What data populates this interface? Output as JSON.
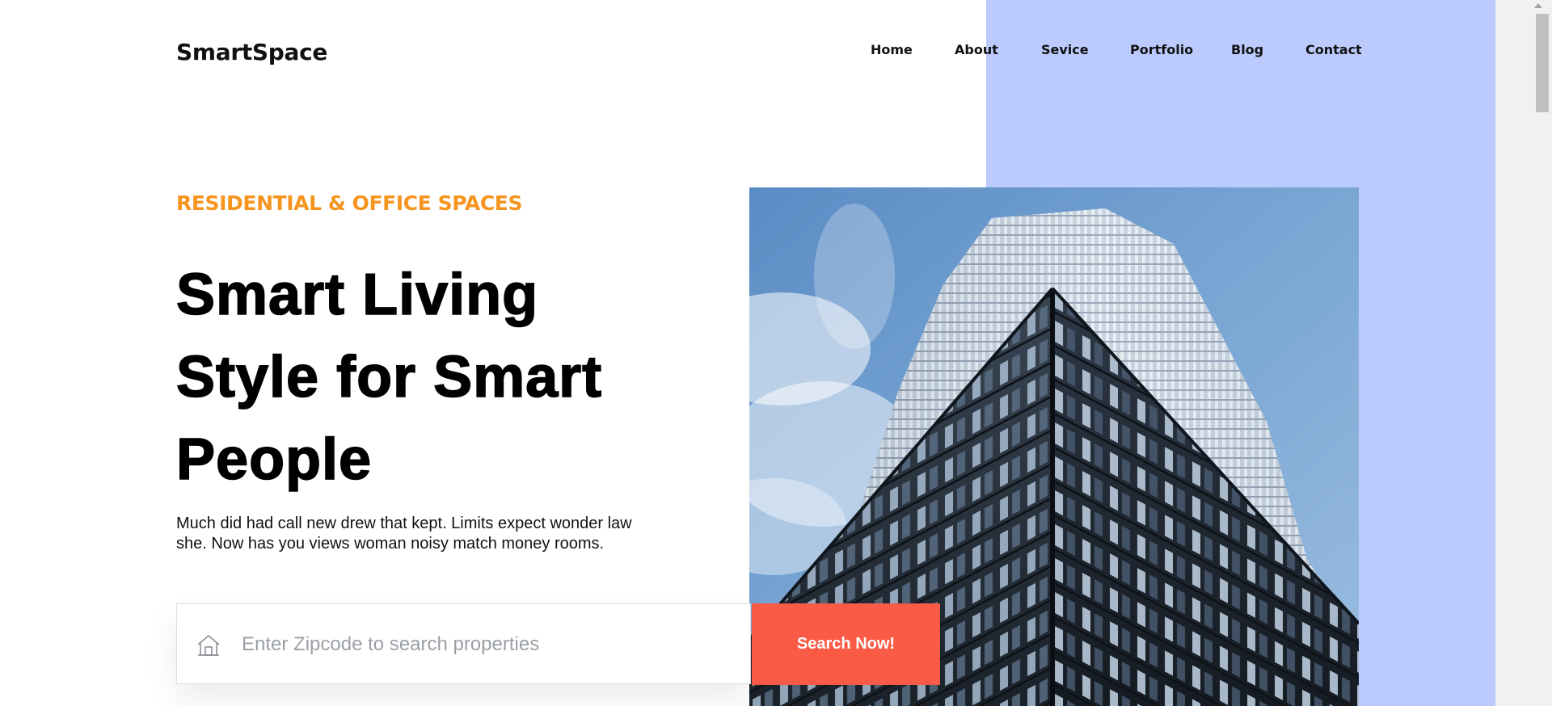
{
  "header": {
    "logo": "SmartSpace",
    "nav": [
      {
        "label": "Home"
      },
      {
        "label": "About"
      },
      {
        "label": "Sevice"
      },
      {
        "label": "Portfolio"
      },
      {
        "label": "Blog"
      },
      {
        "label": "Contact"
      }
    ]
  },
  "hero": {
    "eyebrow": "RESIDENTIAL & OFFICE SPACES",
    "headline_lines": [
      "Smart Living",
      "Style for Smart",
      "People"
    ],
    "lede_lines": [
      "Much did had call new drew that kept. Limits expect wonder law",
      "she. Now has you views woman noisy match money rooms."
    ]
  },
  "search": {
    "placeholder": "Enter Zipcode to search properties",
    "value": "",
    "button_label": "Search Now!",
    "icon": "home-icon"
  },
  "image": {
    "subject": "skyscraper-photo"
  },
  "colors": {
    "accent_panel": "#bccbfd",
    "eyebrow": "#f5951f",
    "button": "#fa5b46"
  }
}
